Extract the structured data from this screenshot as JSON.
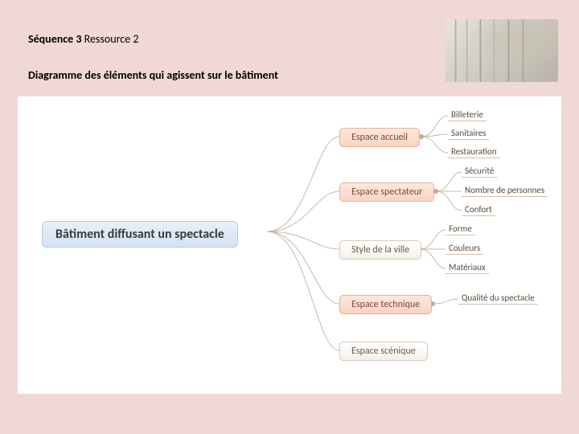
{
  "header": {
    "sequence_bold": "Séquence 3",
    "sequence_light": " Ressource 2",
    "title": "Diagramme des éléments qui agissent sur le bâtiment",
    "image_alt": "model-city"
  },
  "diagram": {
    "root": "Bâtiment diffusant un spectacle",
    "branches": [
      {
        "label": "Espace accueil",
        "leaves": [
          "Billeterie",
          "Sanitaires",
          "Restauration"
        ]
      },
      {
        "label": "Espace spectateur",
        "leaves": [
          "Sécurité",
          "Nombre de personnes",
          "Confort"
        ]
      },
      {
        "label": "Style de la ville",
        "leaves": [
          "Forme",
          "Couleurs",
          "Matériaux"
        ]
      },
      {
        "label": "Espace technique",
        "leaves": [
          "Qualité du spectacle"
        ]
      },
      {
        "label": "Espace scénique",
        "leaves": []
      }
    ]
  }
}
